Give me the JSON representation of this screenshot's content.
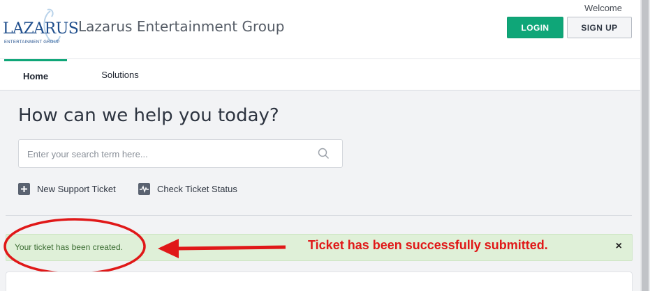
{
  "header": {
    "logo_text": "LAZARUS",
    "logo_subtext": "ENTERTAINMENT GROUP",
    "brand_name": "Lazarus Entertainment Group",
    "welcome": "Welcome",
    "login_label": "LOGIN",
    "signup_label": "SIGN UP"
  },
  "nav": {
    "items": [
      {
        "label": "Home"
      },
      {
        "label": "Solutions"
      }
    ]
  },
  "main": {
    "heading": "How can we help you today?",
    "search": {
      "placeholder": "Enter your search term here...",
      "value": ""
    },
    "links": [
      {
        "label": "New Support Ticket",
        "icon": "plus-icon"
      },
      {
        "label": "Check Ticket Status",
        "icon": "pulse-icon"
      }
    ]
  },
  "alert": {
    "message": "Your ticket has been created.",
    "close": "×"
  },
  "annotation": {
    "text": "Ticket has been successfully submitted.",
    "color": "#e01818"
  },
  "colors": {
    "accent": "#0fa678",
    "alert_bg": "#dff0d8",
    "alert_text": "#3c6d33"
  }
}
